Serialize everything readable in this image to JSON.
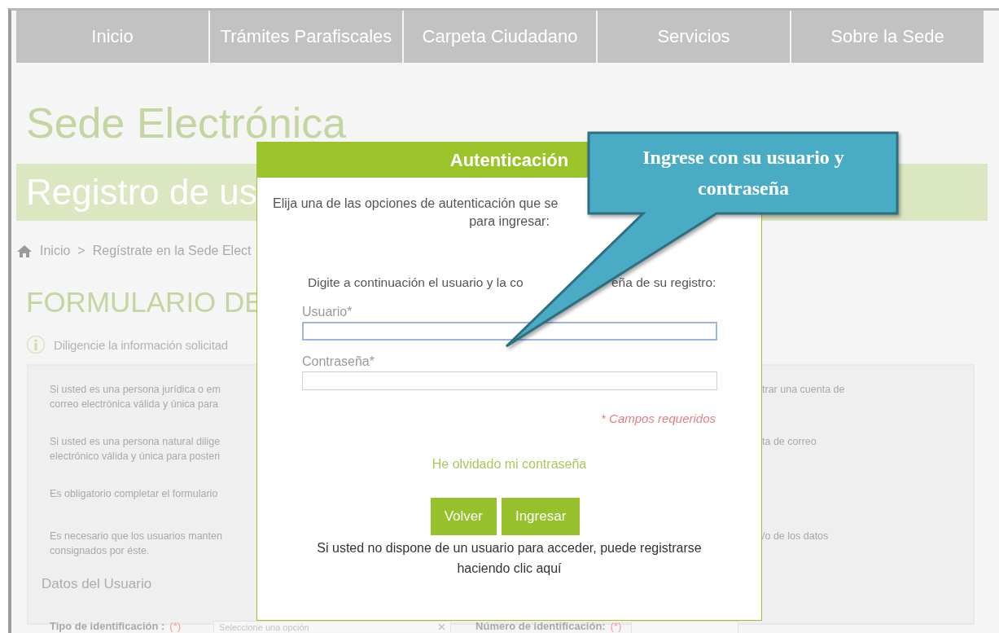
{
  "nav": [
    {
      "label": "Inicio"
    },
    {
      "label": "Trámites Parafiscales"
    },
    {
      "label": "Carpeta Ciudadano"
    },
    {
      "label": "Servicios"
    },
    {
      "label": "Sobre la Sede"
    }
  ],
  "page": {
    "title": "Sede Electrónica",
    "banner": "Registro de us",
    "breadcrumb": [
      {
        "label": "Inicio"
      },
      {
        "label": "Regístrate en la Sede Elect"
      }
    ],
    "separator": ">",
    "heading": "FORMULARIO DE",
    "info": "Diligencie la información solicitad",
    "notices": [
      {
        "left": "Si usted es una persona jurídica o em\ncorreo electrónica válida y única para",
        "right": "trar una cuenta de"
      },
      {
        "left": "Si usted es una persona natural dilige\nelectrónico válida y única para posteri",
        "right": "ta de correo"
      },
      {
        "left": "Es obligatorio completar el formulario"
      },
      {
        "left": "Es necesario que los usuarios manten\nconsignados por éste.",
        "right": "/o de los datos"
      }
    ],
    "section": "Datos del Usuario",
    "fields": [
      {
        "kind": "select",
        "label": "Tipo de identificación :",
        "required": "(*)",
        "placeholder": "Seleccione una opción"
      },
      {
        "kind": "text",
        "label": "Número de identificación:",
        "required": "(*)"
      }
    ]
  },
  "modal": {
    "title": "Autenticación",
    "intro": [
      "Elija una de las opciones de autenticación que se",
      "para ingresar:"
    ],
    "instruction": [
      "Digite a continuación el usuario y la co",
      "eña de su registro:"
    ],
    "fields": [
      {
        "label": "Usuario*",
        "focused": true
      },
      {
        "label": "Contraseña*",
        "focused": false
      }
    ],
    "required_note": "* Campos requeridos",
    "forgot_link": "He olvidado mi contraseña",
    "buttons": [
      "Volver",
      "Ingresar"
    ],
    "footer": "Si usted no dispone de un usuario para acceder, puede registrarse\nhaciendo clic aquí"
  },
  "callout": {
    "text": "Ingrese con su usuario y contraseña"
  }
}
